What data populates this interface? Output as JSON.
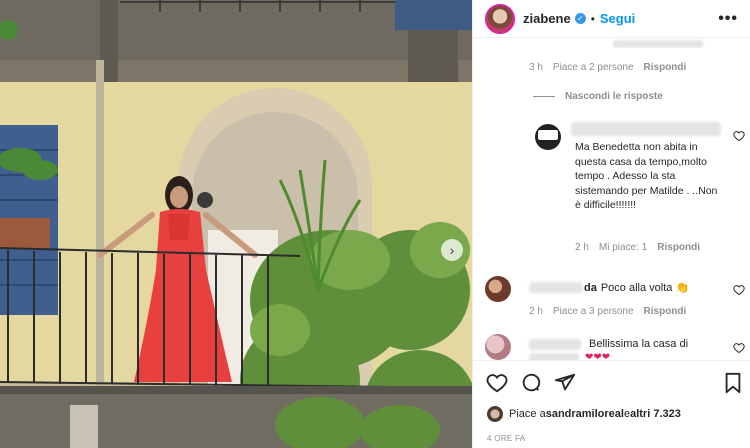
{
  "post": {
    "username": "ziabene",
    "separator": "•",
    "follow_label": "Segui",
    "more_label": "•••"
  },
  "comments": {
    "top_meta": {
      "time": "3 h",
      "likes": "Piace a 2 persone",
      "reply": "Rispondi"
    },
    "hide_replies": "Nascondi le risposte",
    "reply1": {
      "text": "Ma Benedetta non abita in questa casa da tempo,molto tempo . Adesso la sta sistemando per Matilde . ..Non è difficile!!!!!!!",
      "time": "2 h",
      "likes": "Mi piace: 1",
      "reply": "Rispondi"
    },
    "comment2": {
      "name_suffix": "da",
      "text": "Poco alla volta 👏",
      "time": "2 h",
      "likes": "Piace a 3 persone",
      "reply": "Rispondi"
    },
    "comment3": {
      "text_line1": "Bellissima la casa di",
      "hearts": "❤❤❤"
    }
  },
  "footer": {
    "likes_prefix": "Piace a ",
    "likes_user": "sandramiloreal",
    "likes_middle": " e ",
    "likes_others": "altri 7.323",
    "date": "4 ORE FA"
  },
  "colors": {
    "accent": "#0095f6",
    "verified": "#3897f0",
    "dress": "#e8403e"
  }
}
